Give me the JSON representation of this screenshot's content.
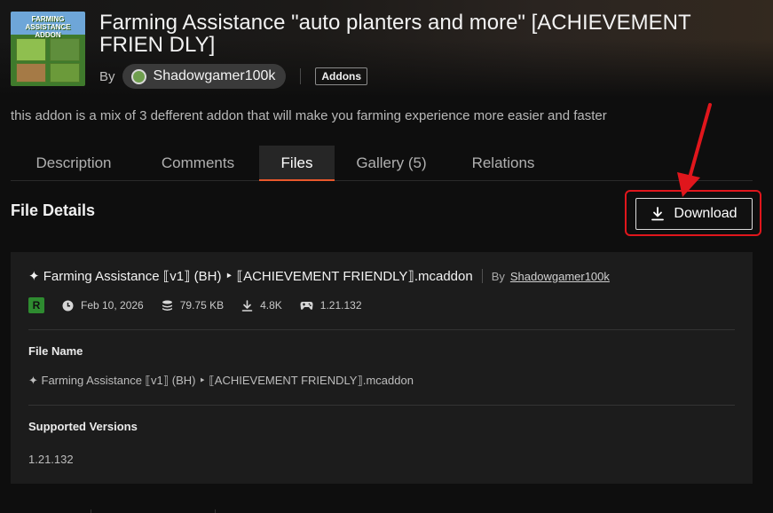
{
  "project": {
    "title": "Farming Assistance \"auto planters and more\" [ACHIEVEMENT FRIEN DLY]",
    "by_label": "By",
    "author": "Shadowgamer100k",
    "category_tag": "Addons",
    "summary": "this addon is a mix of 3 defferent addon that will make you farming experience more easier and faster",
    "thumbnail_text": "FARMING ASSISTANCE ADDON"
  },
  "tabs": [
    {
      "label": "Description",
      "active": false
    },
    {
      "label": "Comments",
      "active": false
    },
    {
      "label": "Files",
      "active": true
    },
    {
      "label": "Gallery (5)",
      "active": false
    },
    {
      "label": "Relations",
      "active": false
    }
  ],
  "file_details": {
    "heading": "File Details",
    "download_label": "Download",
    "file_title": "✦ Farming Assistance ⟦v1⟧ (BH) ‣ ⟦ACHIEVEMENT FRIENDLY⟧.mcaddon",
    "by_label": "By",
    "author": "Shadowgamer100k",
    "release_type": "R",
    "date": "Feb 10, 2026",
    "size": "79.75 KB",
    "downloads": "4.8K",
    "game_version": "1.21.132",
    "file_name_label": "File Name",
    "file_name": "✦ Farming Assistance ⟦v1⟧ (BH) ‣ ⟦ACHIEVEMENT FRIENDLY⟧.mcaddon",
    "supported_versions_label": "Supported Versions",
    "supported_versions": "1.21.132"
  },
  "colors": {
    "accent": "#e8582c",
    "highlight": "#e0161c",
    "release_badge": "#2e8b30"
  },
  "icons": [
    "clock-icon",
    "stack-icon",
    "download-icon",
    "gamepad-icon",
    "avatar-icon"
  ]
}
